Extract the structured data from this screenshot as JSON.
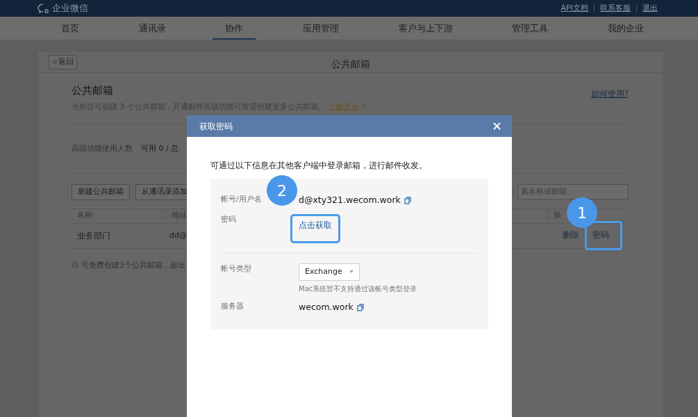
{
  "top_bar": {
    "logo": "企业微信",
    "links": [
      "API文档",
      "联系客服",
      "退出"
    ]
  },
  "nav": [
    {
      "label": "首页",
      "selected": false
    },
    {
      "label": "通讯录",
      "selected": false
    },
    {
      "label": "协作",
      "selected": true
    },
    {
      "label": "应用管理",
      "selected": false
    },
    {
      "label": "客户与上下游",
      "selected": false
    },
    {
      "label": "管理工具",
      "selected": false
    },
    {
      "label": "我的企业",
      "selected": false
    }
  ],
  "page": {
    "back": "返回",
    "title": "公共邮箱"
  },
  "section": {
    "heading": "公共邮箱",
    "description": "当前仅可创建 3 个公共邮箱，开通邮件高级功能可按需创建更多公共邮箱。",
    "learn_more": "了解更多",
    "help_link": "如何使用?"
  },
  "usage": {
    "label": "高级功能使用人数",
    "value": "可用 0 / 总"
  },
  "buttons": [
    "新建公共邮箱",
    "从通讯录添加"
  ],
  "search": {
    "placeholder": "索名称或邮箱"
  },
  "table": {
    "columns": [
      "名称",
      "地址",
      "操"
    ],
    "rows": [
      {
        "name": "业务部门",
        "address": "dd@",
        "actions": [
          {
            "label": "删除",
            "highlighted": false
          },
          {
            "label": "密码",
            "highlighted": true
          }
        ]
      }
    ]
  },
  "note": "可免费创建3个公共邮箱，超出",
  "modal": {
    "title": "获取密码",
    "intro": "可通过以下信息在其他客户端中登录邮箱，进行邮件收发。",
    "fields": [
      {
        "kind": "text",
        "label": "帐号/用户名",
        "value": "d@xty321.wecom.work",
        "copyable": true
      },
      {
        "kind": "link",
        "label": "密码",
        "value": "点击获取",
        "highlighted": true
      },
      {
        "kind": "select",
        "label": "帐号类型",
        "value": "Exchange",
        "hint": "Mac系统暂不支持通过该帐号类型登录"
      },
      {
        "kind": "text",
        "label": "服务器",
        "value": "wecom.work",
        "copyable": true
      }
    ]
  },
  "callouts": [
    "1",
    "2"
  ]
}
